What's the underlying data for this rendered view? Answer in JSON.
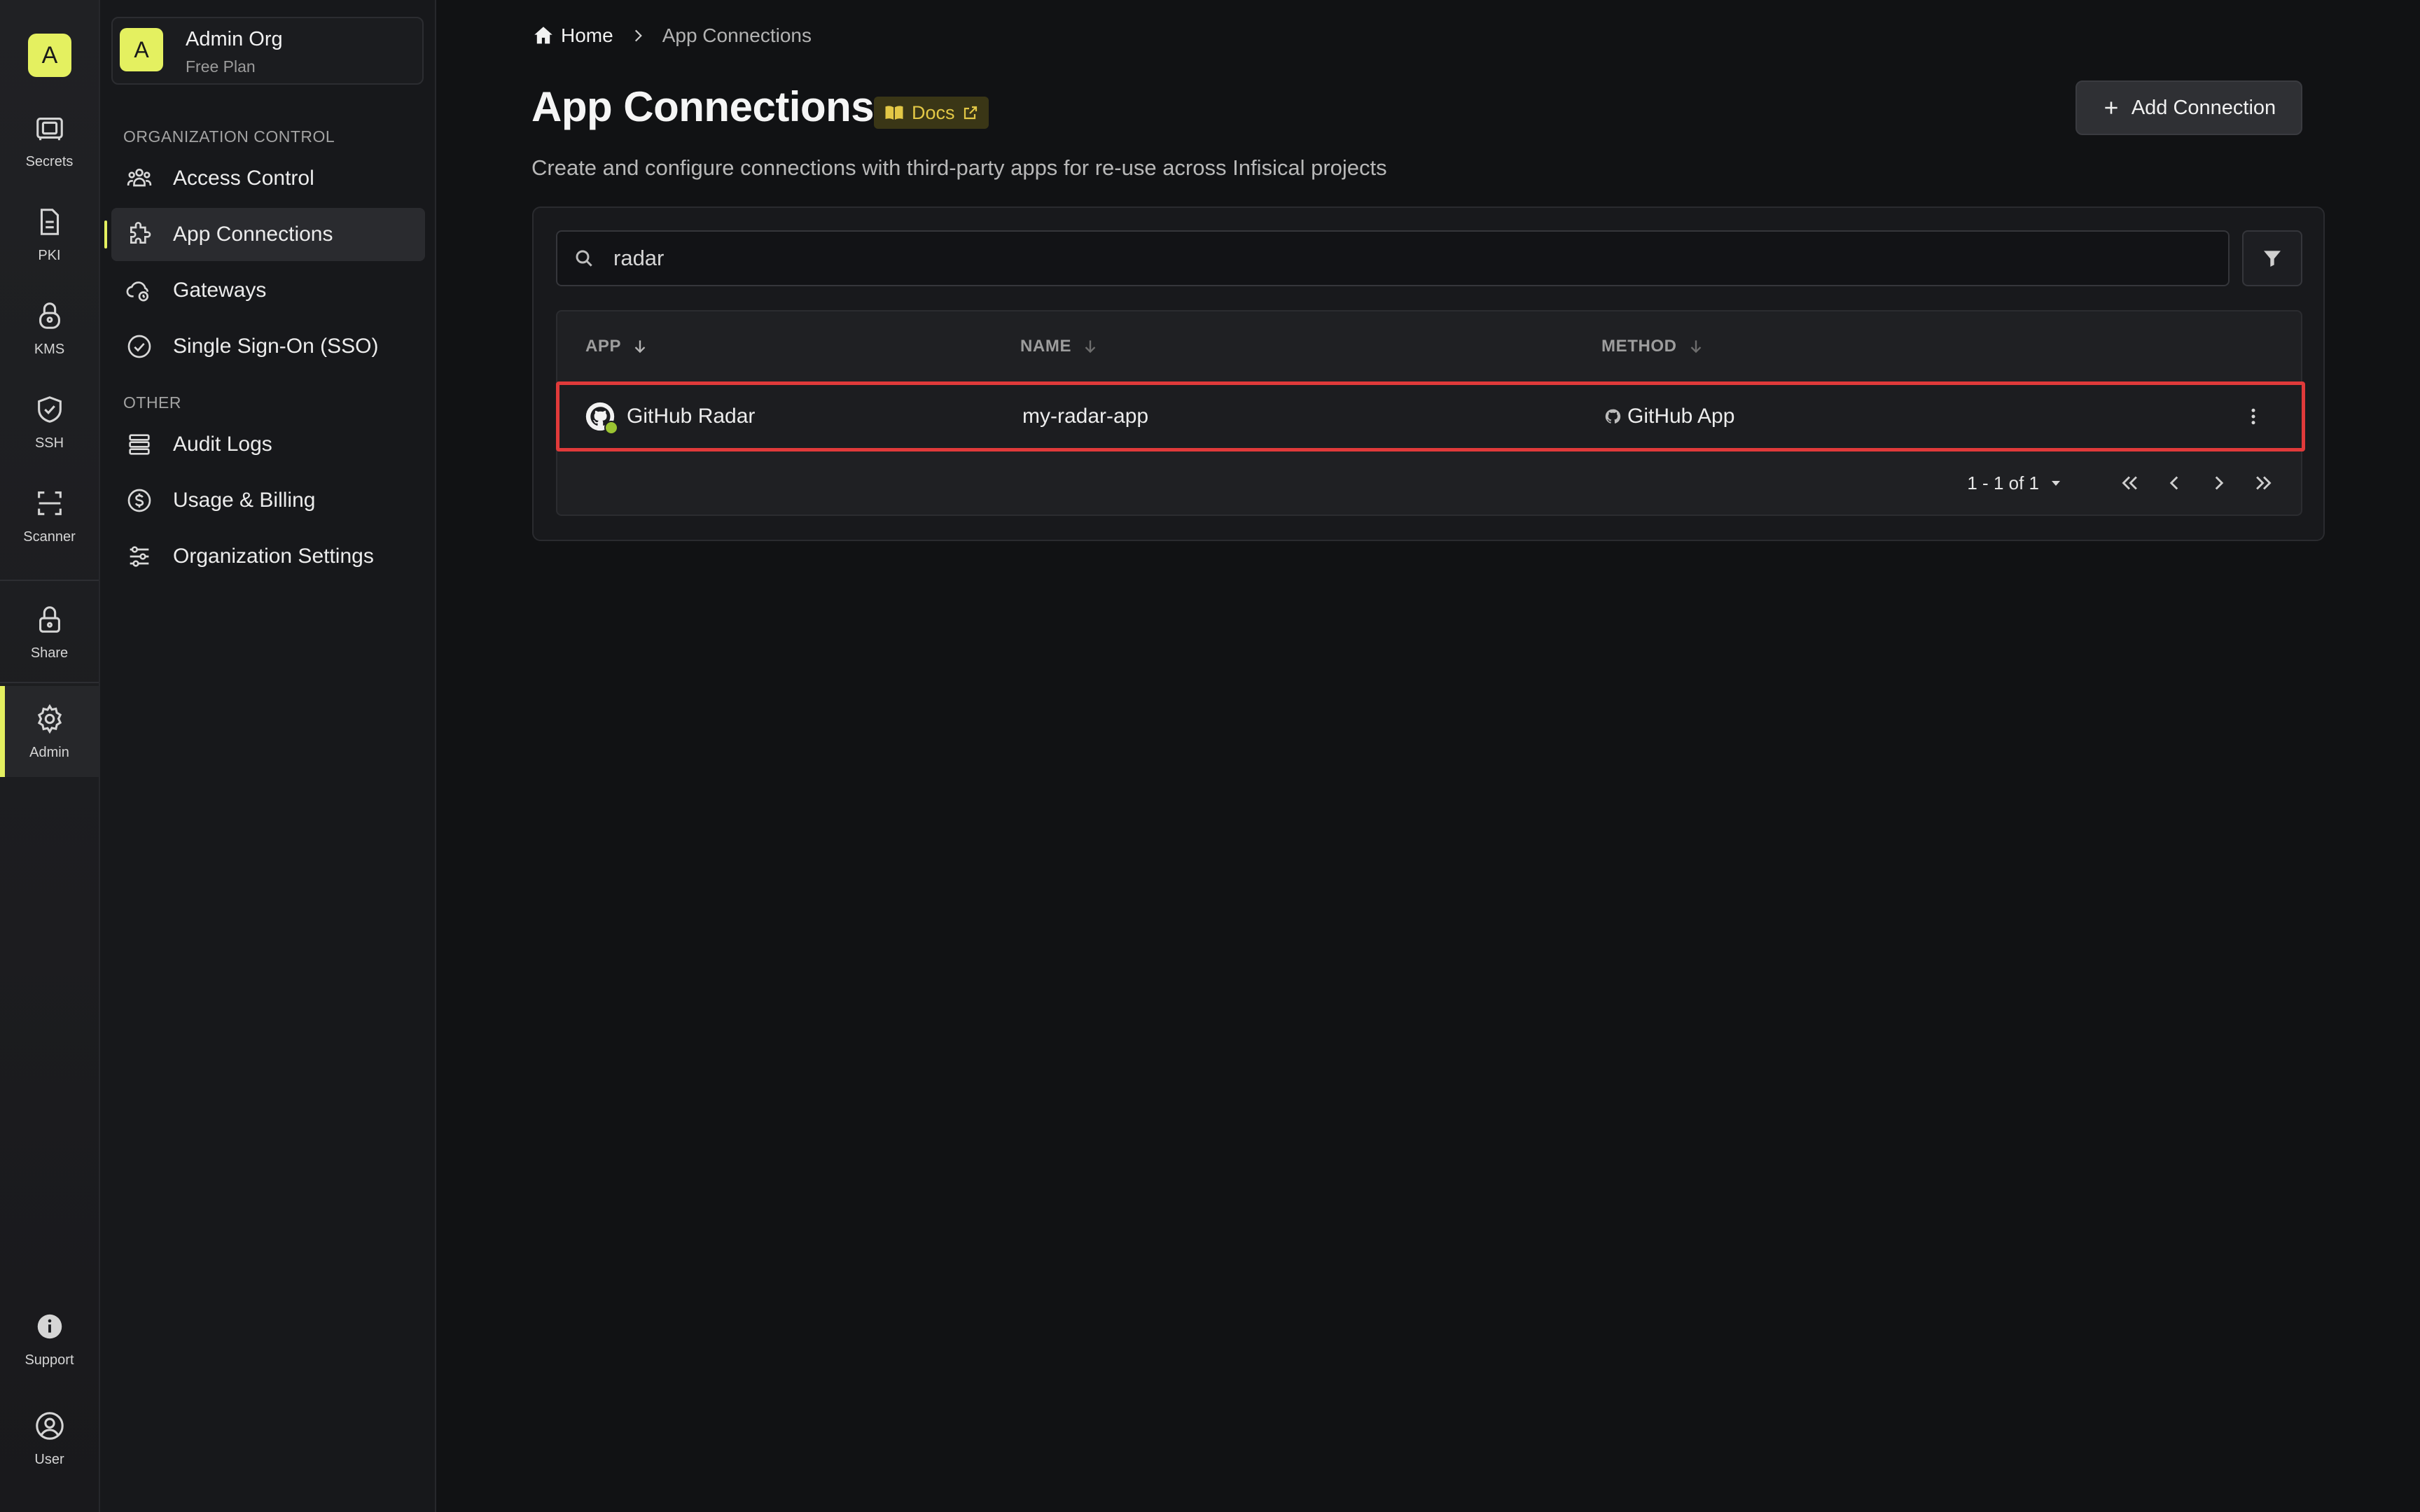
{
  "rail": {
    "logo": "A",
    "items": [
      {
        "label": "Secrets",
        "icon": "vault-icon"
      },
      {
        "label": "PKI",
        "icon": "document-icon"
      },
      {
        "label": "KMS",
        "icon": "lock-key-icon"
      },
      {
        "label": "SSH",
        "icon": "shield-check-icon"
      },
      {
        "label": "Scanner",
        "icon": "scan-icon"
      },
      {
        "label": "Share",
        "icon": "lock-icon"
      },
      {
        "label": "Admin",
        "icon": "gear-icon",
        "active": true
      },
      {
        "label": "Support",
        "icon": "info-icon"
      },
      {
        "label": "User",
        "icon": "user-circle-icon"
      }
    ]
  },
  "org": {
    "avatar": "A",
    "name": "Admin Org",
    "plan": "Free Plan"
  },
  "sidebar": {
    "section_org": "ORGANIZATION CONTROL",
    "section_other": "OTHER",
    "items": [
      {
        "label": "Access Control",
        "icon": "users-icon"
      },
      {
        "label": "App Connections",
        "icon": "puzzle-icon",
        "active": true
      },
      {
        "label": "Gateways",
        "icon": "cloud-icon"
      },
      {
        "label": "Single Sign-On (SSO)",
        "icon": "check-circle-icon"
      },
      {
        "label": "Audit Logs",
        "icon": "list-icon"
      },
      {
        "label": "Usage & Billing",
        "icon": "dollar-icon"
      },
      {
        "label": "Organization Settings",
        "icon": "sliders-icon"
      }
    ]
  },
  "breadcrumb": {
    "home": "Home",
    "current": "App Connections"
  },
  "page": {
    "title": "App Connections",
    "docs_label": "Docs",
    "subtitle": "Create and configure connections with third-party apps for re-use across Infisical projects",
    "add_button": "Add Connection"
  },
  "search": {
    "value": "radar"
  },
  "table": {
    "columns": [
      "APP",
      "NAME",
      "METHOD"
    ],
    "rows": [
      {
        "app": "GitHub Radar",
        "name": "my-radar-app",
        "method": "GitHub App"
      }
    ],
    "pagination": "1 - 1 of 1"
  },
  "colors": {
    "accent": "#e4f060",
    "highlight_border": "#e03a3a",
    "background": "#111214"
  }
}
